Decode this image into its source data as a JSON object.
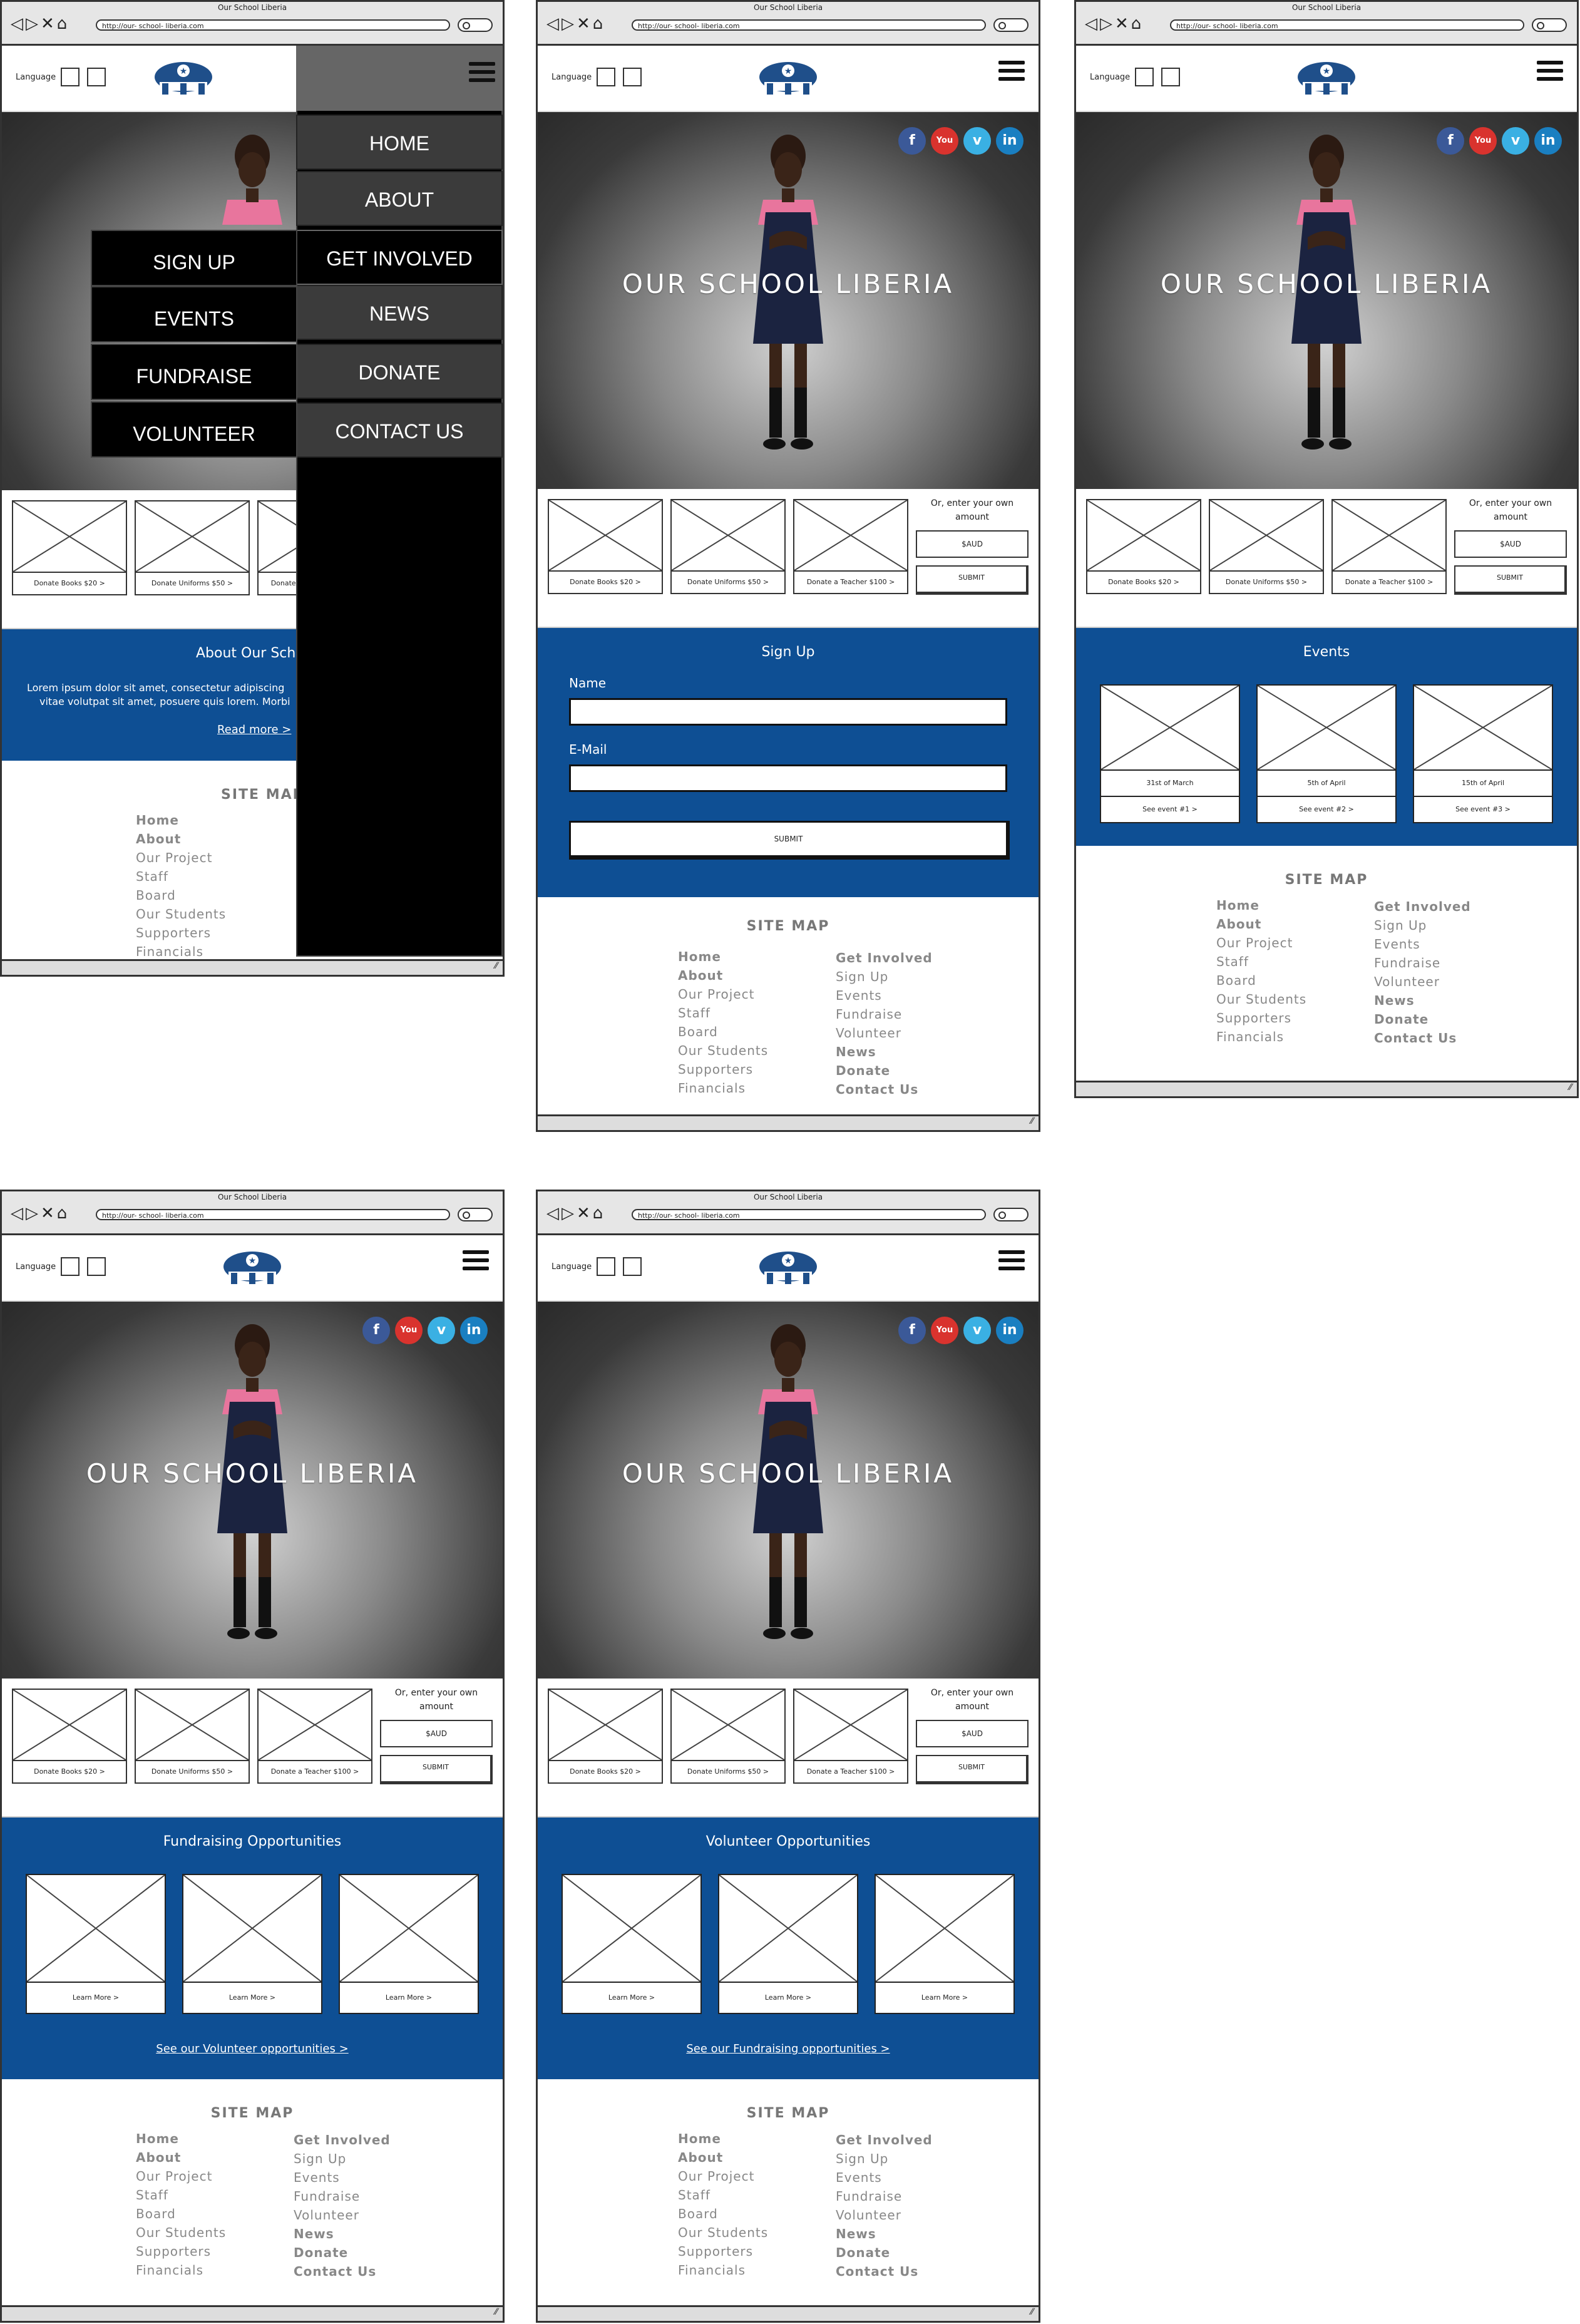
{
  "browser": {
    "title": "Our School Liberia",
    "url": "http://our- school- liberia.com"
  },
  "header": {
    "language_label": "Language"
  },
  "hero": {
    "title": "OUR SCHOOL LIBERIA"
  },
  "social": [
    {
      "icon": "facebook-icon",
      "glyph": "f",
      "color": "#3b5998"
    },
    {
      "icon": "youtube-icon",
      "glyph": "You",
      "color": "#d9332e"
    },
    {
      "icon": "vimeo-icon",
      "glyph": "v",
      "color": "#3ab0e3"
    },
    {
      "icon": "linkedin-icon",
      "glyph": "in",
      "color": "#1a7fc1"
    }
  ],
  "donate": {
    "cards": [
      "Donate Books $20 >",
      "Donate Uniforms $50 >",
      "Donate a Teacher $100 >"
    ],
    "own_amount": "Or, enter your own amount",
    "currency": "$AUD",
    "submit": "SUBMIT"
  },
  "menu": {
    "right": [
      "HOME",
      "ABOUT",
      "GET INVOLVED",
      "NEWS",
      "DONATE",
      "CONTACT US"
    ],
    "left": [
      "SIGN UP",
      "EVENTS",
      "FUNDRAISE",
      "VOLUNTEER"
    ]
  },
  "about": {
    "title": "About Our Sch",
    "body_line1": "Lorem ipsum dolor sit amet, consectetur adipiscing",
    "body_line2": "vitae volutpat sit amet, posuere quis lorem. Morbi",
    "read_more": "Read more >"
  },
  "signup": {
    "title": "Sign Up",
    "name_label": "Name",
    "email_label": "E-Mail",
    "submit": "SUBMIT"
  },
  "events": {
    "title": "Events",
    "items": [
      {
        "date": "31st of March",
        "link": "See event #1 >"
      },
      {
        "date": "5th of April",
        "link": "See event #2 >"
      },
      {
        "date": "15th of April",
        "link": "See event #3 >"
      }
    ]
  },
  "fundraising": {
    "title": "Fundraising Opportunities",
    "items": [
      "Learn More >",
      "Learn More >",
      "Learn More >"
    ],
    "link": "See our Volunteer opportunities >"
  },
  "volunteer": {
    "title": "Volunteer Opportunities",
    "items": [
      "Learn More >",
      "Learn More >",
      "Learn More >"
    ],
    "link": "See our Fundraising opportunities >"
  },
  "sitemap": {
    "title": "SITE MAP",
    "col1": [
      "Home",
      "About",
      "Our Project",
      "Staff",
      "Board",
      "Our Students",
      "Supporters",
      "Financials"
    ],
    "col2": [
      "Get Involved",
      "Sign Up",
      "Events",
      "Fundraise",
      "Volunteer",
      "News",
      "Donate",
      "Contact Us"
    ]
  }
}
